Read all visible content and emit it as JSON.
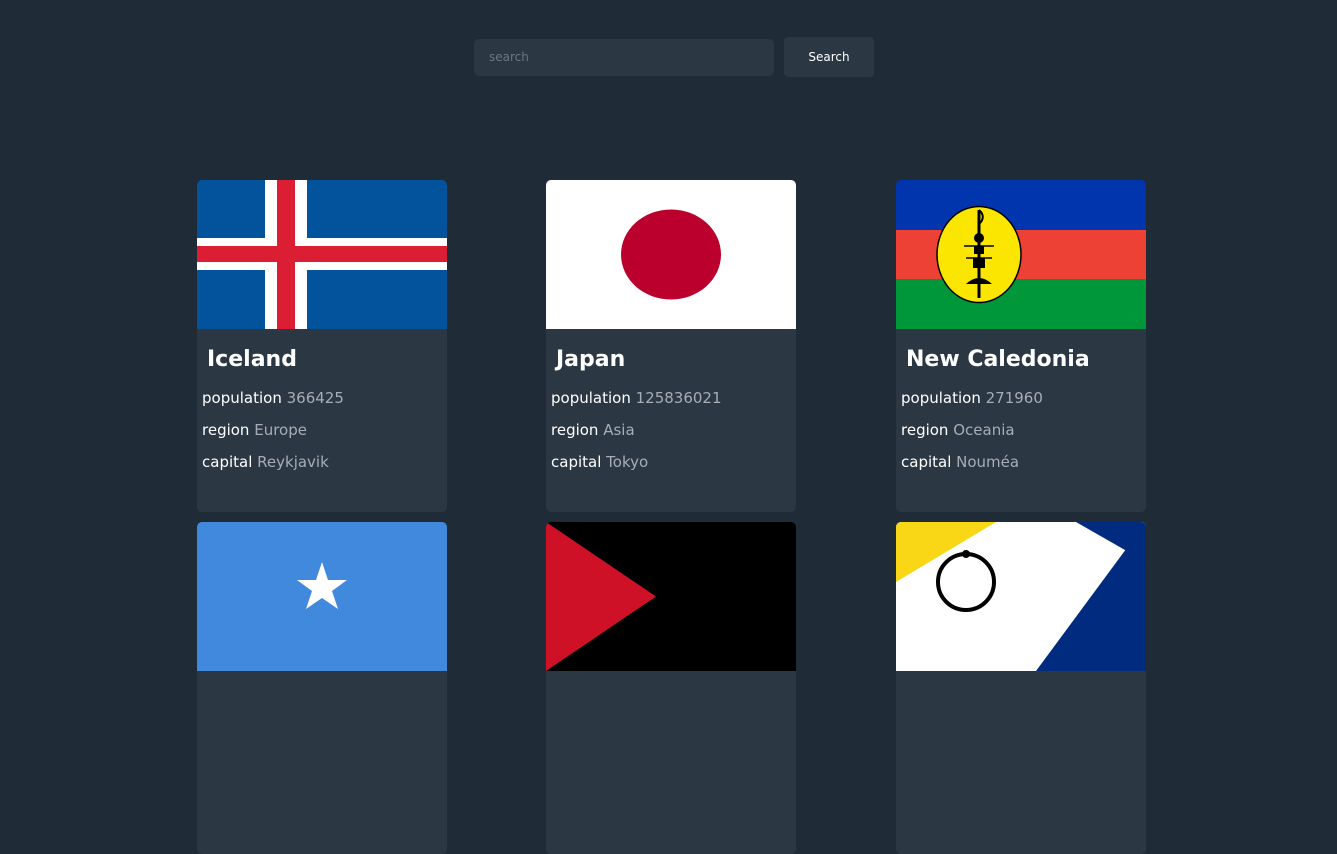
{
  "search": {
    "placeholder": "search",
    "value": "",
    "button_label": "Search"
  },
  "labels": {
    "population": "population",
    "region": "region",
    "capital": "capital"
  },
  "countries": [
    {
      "name": "Iceland",
      "population": "366425",
      "region": "Europe",
      "capital": "Reykjavik",
      "flag": "iceland-flag"
    },
    {
      "name": "Japan",
      "population": "125836021",
      "region": "Asia",
      "capital": "Tokyo",
      "flag": "japan-flag"
    },
    {
      "name": "New Caledonia",
      "population": "271960",
      "region": "Oceania",
      "capital": "Nouméa",
      "flag": "new-caledonia-flag"
    },
    {
      "flag": "somalia-flag"
    },
    {
      "flag": "partial-flag-red-black"
    },
    {
      "flag": "partial-flag-yellow-white-blue"
    }
  ],
  "colors": {
    "background": "#202b38",
    "surface": "#2b3743",
    "muted_text": "#a7adb4"
  }
}
